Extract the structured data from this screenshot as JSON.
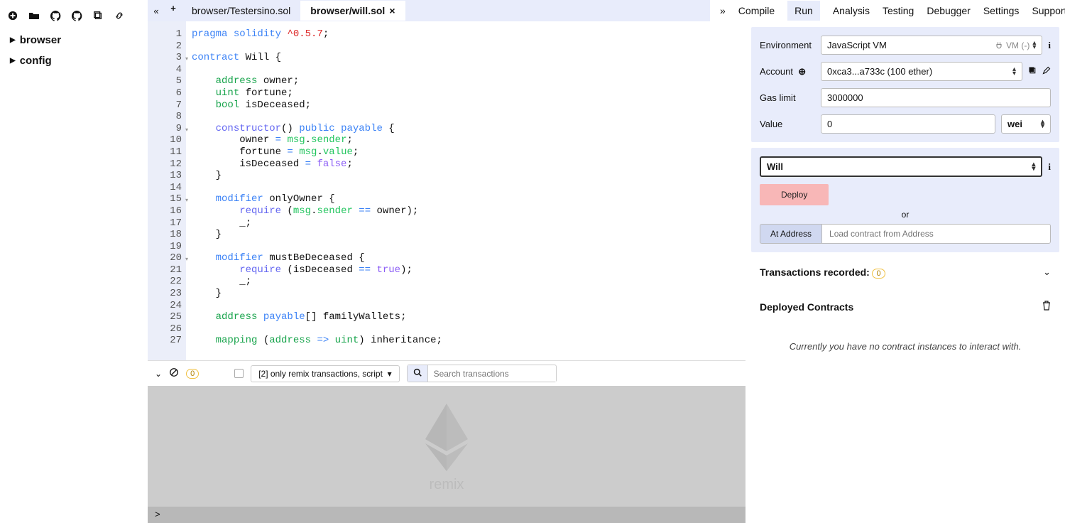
{
  "file_tree": {
    "items": [
      "browser",
      "config"
    ]
  },
  "tabs": {
    "inactive": "browser/Testersino.sol",
    "active": "browser/will.sol"
  },
  "topnav": {
    "items": [
      "Compile",
      "Run",
      "Analysis",
      "Testing",
      "Debugger",
      "Settings",
      "Support"
    ],
    "active": "Run"
  },
  "code": {
    "lines": [
      [
        {
          "t": "pragma",
          "c": "kw"
        },
        {
          "t": " "
        },
        {
          "t": "solidity",
          "c": "kw"
        },
        {
          "t": " "
        },
        {
          "t": "^0.5.7",
          "c": "str"
        },
        {
          "t": ";"
        }
      ],
      [],
      [
        {
          "t": "contract",
          "c": "kw"
        },
        {
          "t": " Will {"
        }
      ],
      [],
      [
        {
          "t": "    "
        },
        {
          "t": "address",
          "c": "kw2"
        },
        {
          "t": " owner;"
        }
      ],
      [
        {
          "t": "    "
        },
        {
          "t": "uint",
          "c": "kw2"
        },
        {
          "t": " fortune;"
        }
      ],
      [
        {
          "t": "    "
        },
        {
          "t": "bool",
          "c": "kw2"
        },
        {
          "t": " isDeceased;"
        }
      ],
      [],
      [
        {
          "t": "    "
        },
        {
          "t": "constructor",
          "c": "fn"
        },
        {
          "t": "() "
        },
        {
          "t": "public",
          "c": "kw"
        },
        {
          "t": " "
        },
        {
          "t": "payable",
          "c": "kw"
        },
        {
          "t": " {"
        }
      ],
      [
        {
          "t": "        owner "
        },
        {
          "t": "=",
          "c": "kw"
        },
        {
          "t": " "
        },
        {
          "t": "msg",
          "c": "id"
        },
        {
          "t": "."
        },
        {
          "t": "sender",
          "c": "id"
        },
        {
          "t": ";"
        }
      ],
      [
        {
          "t": "        fortune "
        },
        {
          "t": "=",
          "c": "kw"
        },
        {
          "t": " "
        },
        {
          "t": "msg",
          "c": "id"
        },
        {
          "t": "."
        },
        {
          "t": "value",
          "c": "id"
        },
        {
          "t": ";"
        }
      ],
      [
        {
          "t": "        isDeceased "
        },
        {
          "t": "=",
          "c": "kw"
        },
        {
          "t": " "
        },
        {
          "t": "false",
          "c": "bool"
        },
        {
          "t": ";"
        }
      ],
      [
        {
          "t": "    }"
        }
      ],
      [],
      [
        {
          "t": "    "
        },
        {
          "t": "modifier",
          "c": "kw"
        },
        {
          "t": " onlyOwner {"
        }
      ],
      [
        {
          "t": "        "
        },
        {
          "t": "require",
          "c": "fn"
        },
        {
          "t": " ("
        },
        {
          "t": "msg",
          "c": "id"
        },
        {
          "t": "."
        },
        {
          "t": "sender",
          "c": "id"
        },
        {
          "t": " "
        },
        {
          "t": "==",
          "c": "kw"
        },
        {
          "t": " owner);"
        }
      ],
      [
        {
          "t": "        _;"
        }
      ],
      [
        {
          "t": "    }"
        }
      ],
      [],
      [
        {
          "t": "    "
        },
        {
          "t": "modifier",
          "c": "kw"
        },
        {
          "t": " mustBeDeceased {"
        }
      ],
      [
        {
          "t": "        "
        },
        {
          "t": "require",
          "c": "fn"
        },
        {
          "t": " (isDeceased "
        },
        {
          "t": "==",
          "c": "kw"
        },
        {
          "t": " "
        },
        {
          "t": "true",
          "c": "bool"
        },
        {
          "t": ");"
        }
      ],
      [
        {
          "t": "        _;"
        }
      ],
      [
        {
          "t": "    }"
        }
      ],
      [],
      [
        {
          "t": "    "
        },
        {
          "t": "address",
          "c": "kw2"
        },
        {
          "t": " "
        },
        {
          "t": "payable",
          "c": "kw"
        },
        {
          "t": "[] familyWallets;"
        }
      ],
      [],
      [
        {
          "t": "    "
        },
        {
          "t": "mapping",
          "c": "kw2"
        },
        {
          "t": " ("
        },
        {
          "t": "address",
          "c": "kw2"
        },
        {
          "t": " "
        },
        {
          "t": "=>",
          "c": "kw"
        },
        {
          "t": " "
        },
        {
          "t": "uint",
          "c": "kw2"
        },
        {
          "t": ") inheritance;"
        }
      ]
    ],
    "foldable": [
      3,
      9,
      15,
      20
    ]
  },
  "terminal": {
    "pending": "0",
    "filter_label": "[2] only remix transactions, script",
    "search_placeholder": "Search transactions",
    "prompt": ">",
    "logo_text": "remix"
  },
  "run_panel": {
    "env_label": "Environment",
    "env_value": "JavaScript VM",
    "vm_badge": "VM (-)",
    "account_label": "Account",
    "account_value": "0xca3...a733c (100 ether)",
    "gas_label": "Gas limit",
    "gas_value": "3000000",
    "value_label": "Value",
    "value_value": "0",
    "value_unit": "wei",
    "contract_selected": "Will",
    "deploy_label": "Deploy",
    "or_label": "or",
    "ataddress_label": "At Address",
    "ataddress_placeholder": "Load contract from Address",
    "tx_recorded_label": "Transactions recorded:",
    "tx_recorded_count": "0",
    "deployed_label": "Deployed Contracts",
    "empty_msg": "Currently you have no contract instances to interact with."
  }
}
